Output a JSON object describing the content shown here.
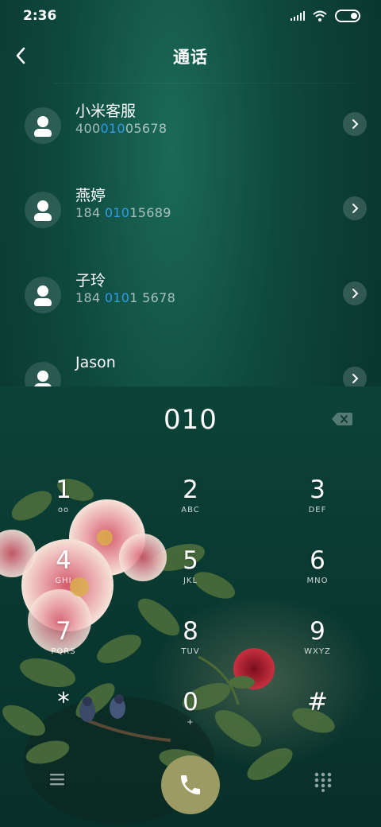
{
  "status": {
    "time": "2:36"
  },
  "header": {
    "title": "通话"
  },
  "contacts": [
    {
      "name": "小米客服",
      "num_pre": "400",
      "num_match": "010",
      "num_post": "05678"
    },
    {
      "name": "燕婷",
      "num_pre": "184 ",
      "num_match": "010",
      "num_post": "15689"
    },
    {
      "name": "子玲",
      "num_pre": "184 ",
      "num_match": "010",
      "num_post": "1 5678"
    },
    {
      "name": "Jason",
      "num_pre": "",
      "num_match": "",
      "num_post": ""
    }
  ],
  "dialer": {
    "entered": "010",
    "keys": [
      {
        "digit": "1",
        "letters": "oo"
      },
      {
        "digit": "2",
        "letters": "ABC"
      },
      {
        "digit": "3",
        "letters": "DEF"
      },
      {
        "digit": "4",
        "letters": "GHI"
      },
      {
        "digit": "5",
        "letters": "JKL"
      },
      {
        "digit": "6",
        "letters": "MNO"
      },
      {
        "digit": "7",
        "letters": "PQRS"
      },
      {
        "digit": "8",
        "letters": "TUV"
      },
      {
        "digit": "9",
        "letters": "WXYZ"
      },
      {
        "digit": "*",
        "letters": ""
      },
      {
        "digit": "0",
        "letters": "+"
      },
      {
        "digit": "#",
        "letters": ""
      }
    ]
  },
  "icons": {
    "back": "back-arrow-icon",
    "chevron": "chevron-right-icon",
    "backspace": "backspace-icon",
    "menu": "menu-icon",
    "call": "phone-icon",
    "keypad": "keypad-icon"
  },
  "colors": {
    "accent_match": "#2f9be9",
    "call_button": "#9c9b63",
    "background": "#0a3a31"
  }
}
